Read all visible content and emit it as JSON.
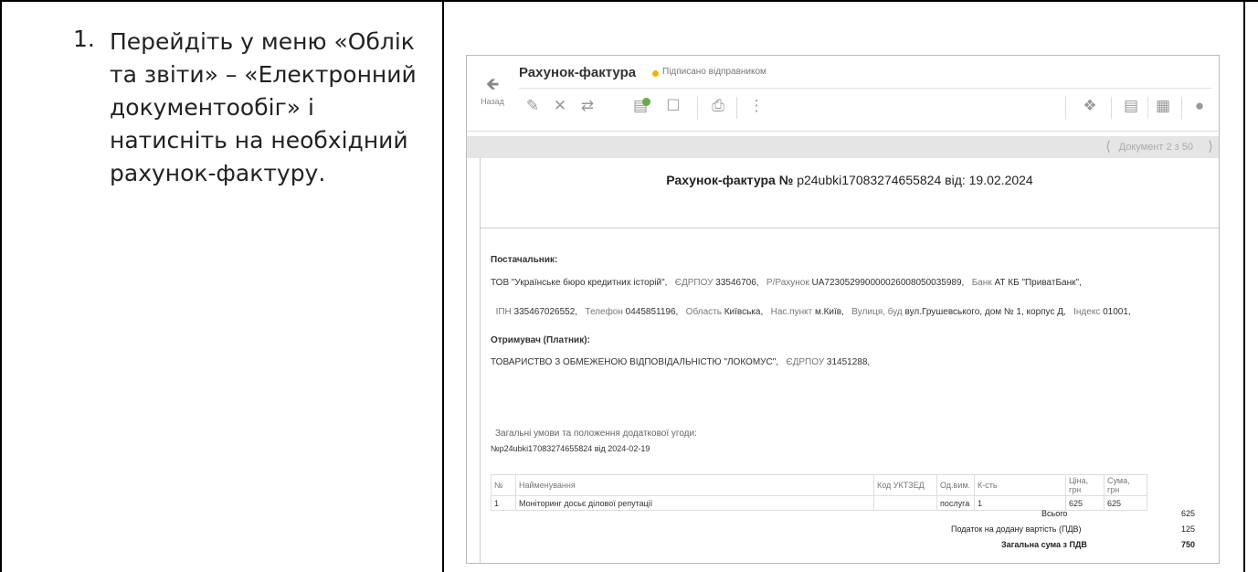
{
  "instruction": {
    "number": "1.",
    "lines": [
      "Перейдіть у меню «Облік",
      "та звіти» – «Електронний",
      "документообіг» і",
      "натисніть на необхідний",
      "рахунок-фактуру."
    ]
  },
  "app": {
    "back_label": "Назад",
    "title": "Рахунок-фактура",
    "status": "Підписано відправником",
    "nav_text": "Документ 2 з 50"
  },
  "document": {
    "heading_bold": "Рахунок-фактура №",
    "heading_number": "p24ubki17083274655824",
    "heading_from": "від:",
    "heading_date": "19.02.2024",
    "supplier_label": "Постачальник:",
    "supplier_name": "ТОВ \"Українське бюро кредитних історій\",",
    "edrpou_label": "ЄДРПОУ",
    "supplier_edrpou": "33546706,",
    "account_label": "Р/Рахунок",
    "supplier_account": "UA723052990000026008050035989,",
    "bank_label": "Банк",
    "supplier_bank": "АТ КБ \"ПриватБанк\",",
    "ipn_label": "ІПН",
    "supplier_ipn": "335467026552,",
    "phone_label": "Телефон",
    "supplier_phone": "0445851196,",
    "region_label": "Область",
    "supplier_region": "Київська,",
    "city_label": "Нас.пункт",
    "supplier_city": "м.Київ,",
    "street_label": "Вулиця, буд",
    "supplier_street": "вул.Грушевського, дом № 1, корпус Д,",
    "index_label": "Індекс",
    "supplier_index": "01001,",
    "buyer_label": "Отримувач (Платник):",
    "buyer_name": "ТОВАРИСТВО З ОБМЕЖЕНОЮ ВІДПОВІДАЛЬНІСТЮ \"ЛОКОМУС\",",
    "buyer_edrpou_label": "ЄДРПОУ",
    "buyer_edrpou": "31451288,",
    "terms_label": "Загальні умови та положення додаткової угоди:",
    "terms_value": "№p24ubki17083274655824 від 2024-02-19"
  },
  "table": {
    "headers": [
      "№",
      "Найменування",
      "Код УКТЗЕД",
      "Од.вим.",
      "К-сть",
      "Ціна, грн",
      "Сума, грн"
    ],
    "rows": [
      [
        "1",
        "Моніторинг досьє ділової репутації",
        "",
        "послуга",
        "1",
        "625",
        "625"
      ]
    ]
  },
  "totals": {
    "total_label": "Всього",
    "total_value": "625",
    "vat_label": "Податок на додану вартість (ПДВ)",
    "vat_value": "125",
    "grand_label": "Загальна сума з ПДВ",
    "grand_value": "750"
  },
  "icons": {
    "edit": "pencil-icon",
    "delete": "close-icon",
    "exchange": "swap-icon",
    "doc_badge": "document-badge-icon",
    "unsign": "unsign-icon",
    "print": "printer-icon",
    "more": "more-icon",
    "pin": "pin-icon",
    "view": "list-icon",
    "file": "file-icon",
    "chat": "comment-icon"
  },
  "colors": {
    "status_dot": "#f0b400",
    "badge": "#6aa84f"
  }
}
